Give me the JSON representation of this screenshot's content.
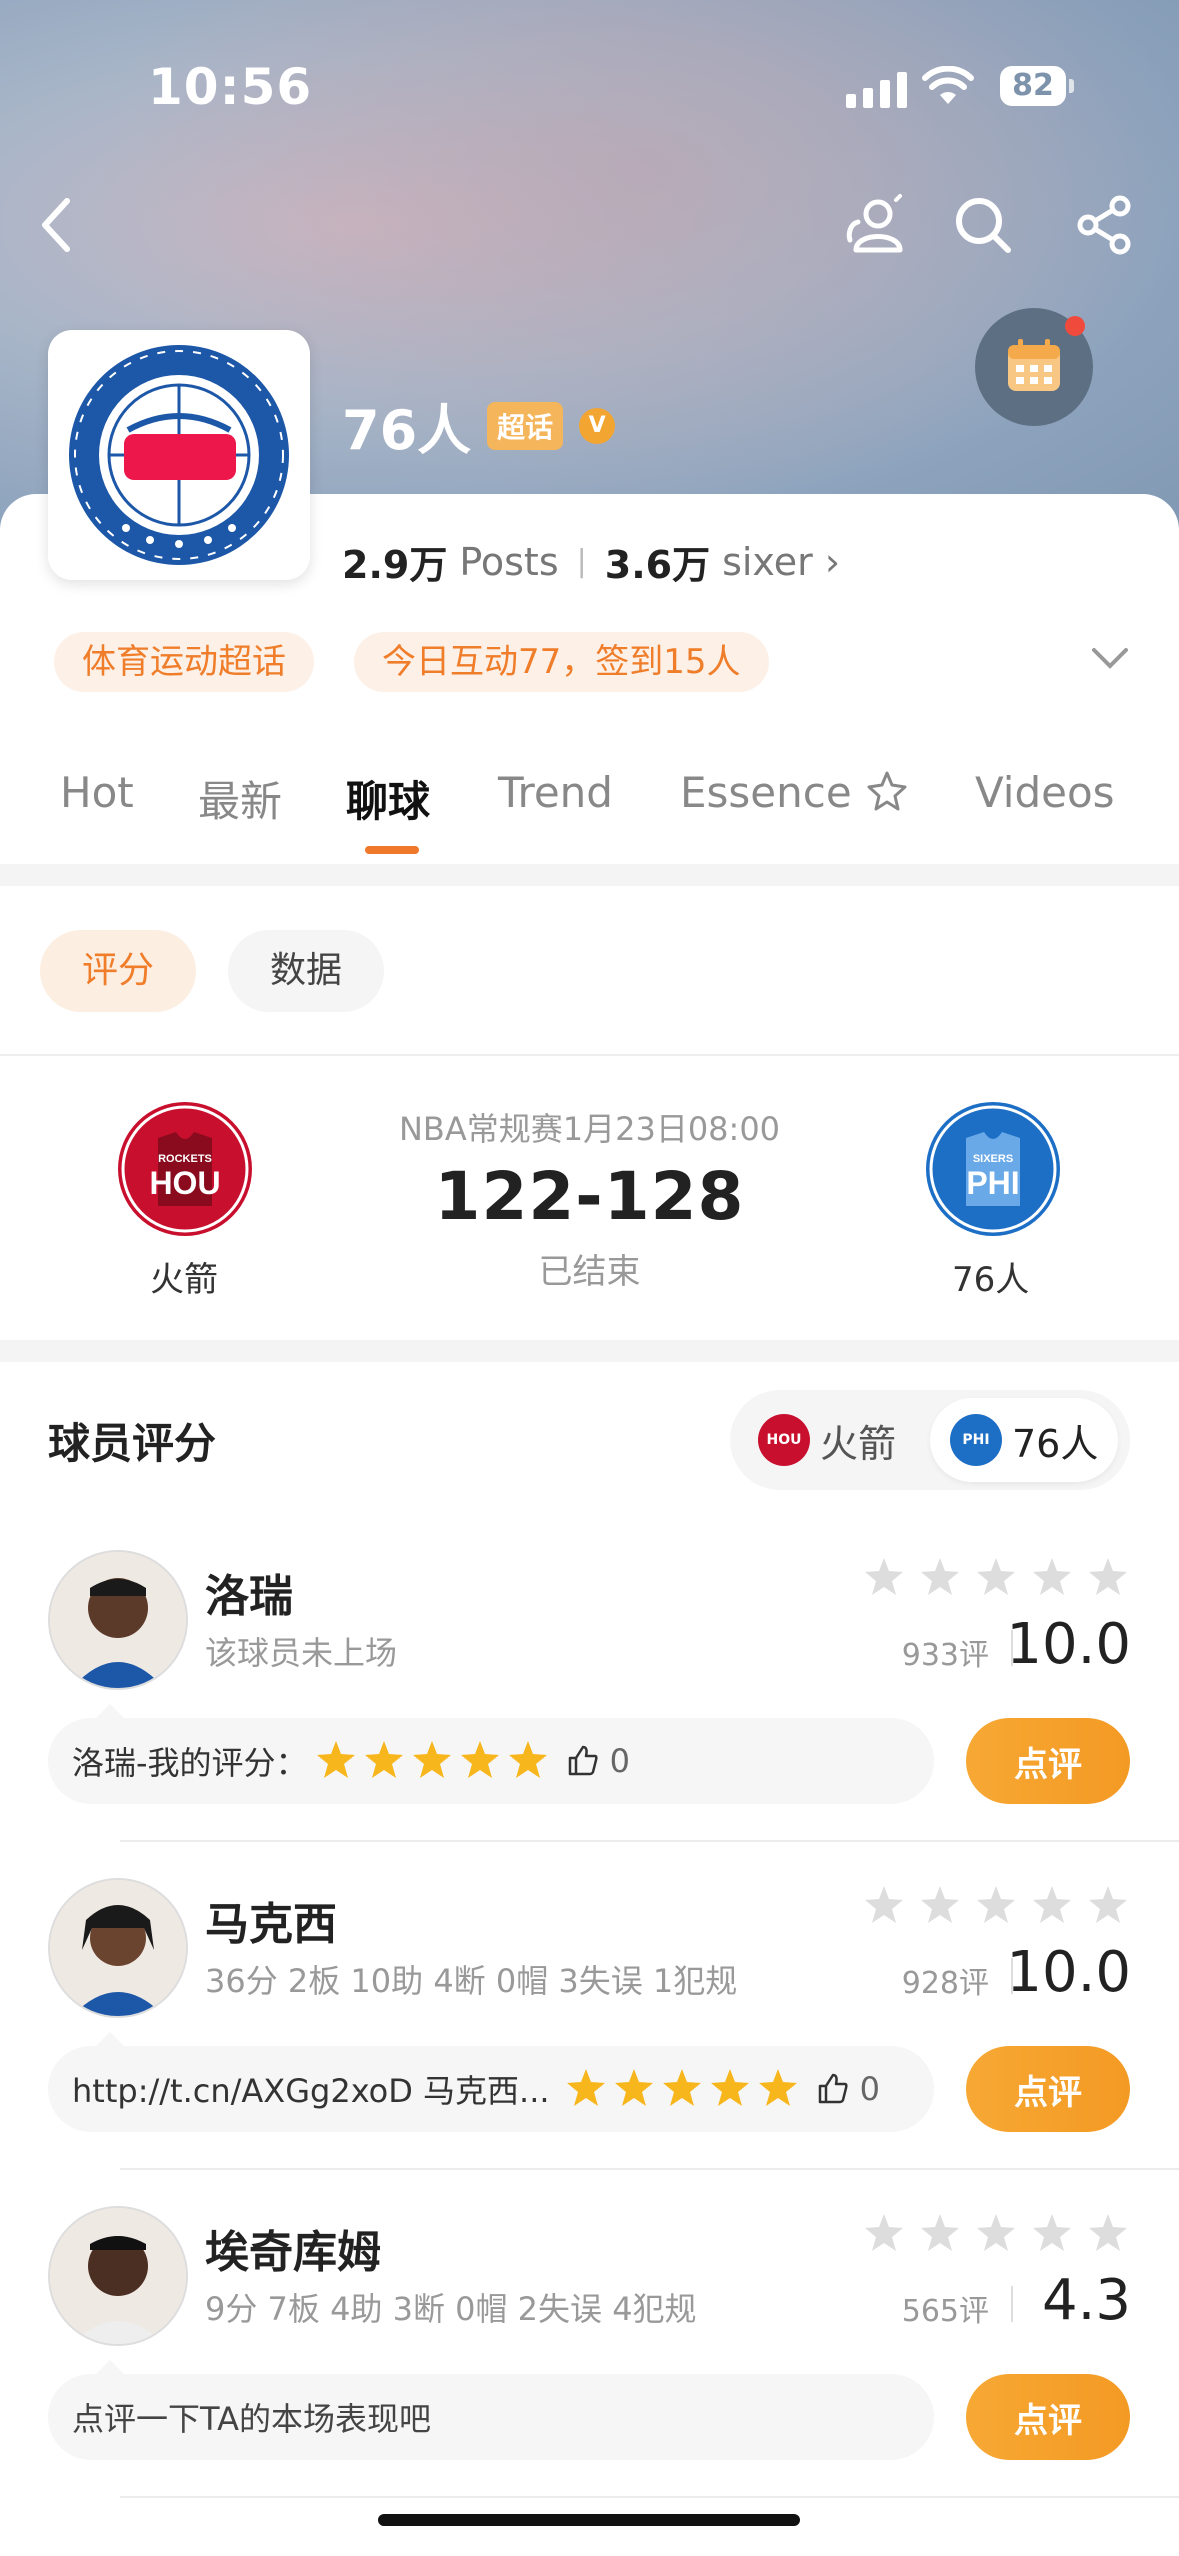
{
  "status_bar": {
    "time": "10:56",
    "battery": "82"
  },
  "team": {
    "name": "76人",
    "super_tag": "超话",
    "v_badge": "V"
  },
  "stats": {
    "posts_num": "2.9万",
    "posts_label": "Posts",
    "sep": "|",
    "fans_num": "3.6万",
    "fans_label": "sixer",
    "fans_arrow": "›"
  },
  "tags": [
    "体育运动超话",
    "今日互动77，签到15人"
  ],
  "tabs": [
    {
      "label": "Hot"
    },
    {
      "label": "最新"
    },
    {
      "label": "聊球",
      "active": true
    },
    {
      "label": "Trend"
    },
    {
      "label": "Essence"
    },
    {
      "label": "Videos"
    }
  ],
  "filters": [
    {
      "label": "评分",
      "active": true
    },
    {
      "label": "数据",
      "active": false
    }
  ],
  "match": {
    "meta": "NBA常规赛1月23日08:00",
    "score": "122-128",
    "state": "已结束",
    "home": {
      "name": "火箭",
      "abbr": "HOU",
      "sub": "ROCKETS",
      "color": "#c8102e"
    },
    "away": {
      "name": "76人",
      "abbr": "PHI",
      "sub": "SIXERS",
      "color": "#1d6fc6"
    }
  },
  "ratings_section": {
    "title": "球员评分",
    "switch": [
      {
        "label": "火箭"
      },
      {
        "label": "76人",
        "active": true
      }
    ]
  },
  "players": [
    {
      "name": "洛瑞",
      "line": "该球员未上场",
      "count": "933评",
      "rating": "10.0",
      "comment": "洛瑞-我的评分：",
      "comment_stars": 5,
      "likes": "0",
      "btn": "点评"
    },
    {
      "name": "马克西",
      "line": "36分 2板 10助 4断 0帽 3失误 1犯规",
      "count": "928评",
      "rating": "10.0",
      "comment": "http://t.cn/AXGg2xoD 马克西...",
      "comment_stars": 5,
      "likes": "0",
      "btn": "点评"
    },
    {
      "name": "埃奇库姆",
      "line": "9分 7板 4助 3断 0帽 2失误 4犯规",
      "count": "565评",
      "rating": "4.3",
      "comment": "点评一下TA的本场表现吧",
      "comment_stars": 0,
      "likes": "",
      "btn": "点评"
    }
  ]
}
